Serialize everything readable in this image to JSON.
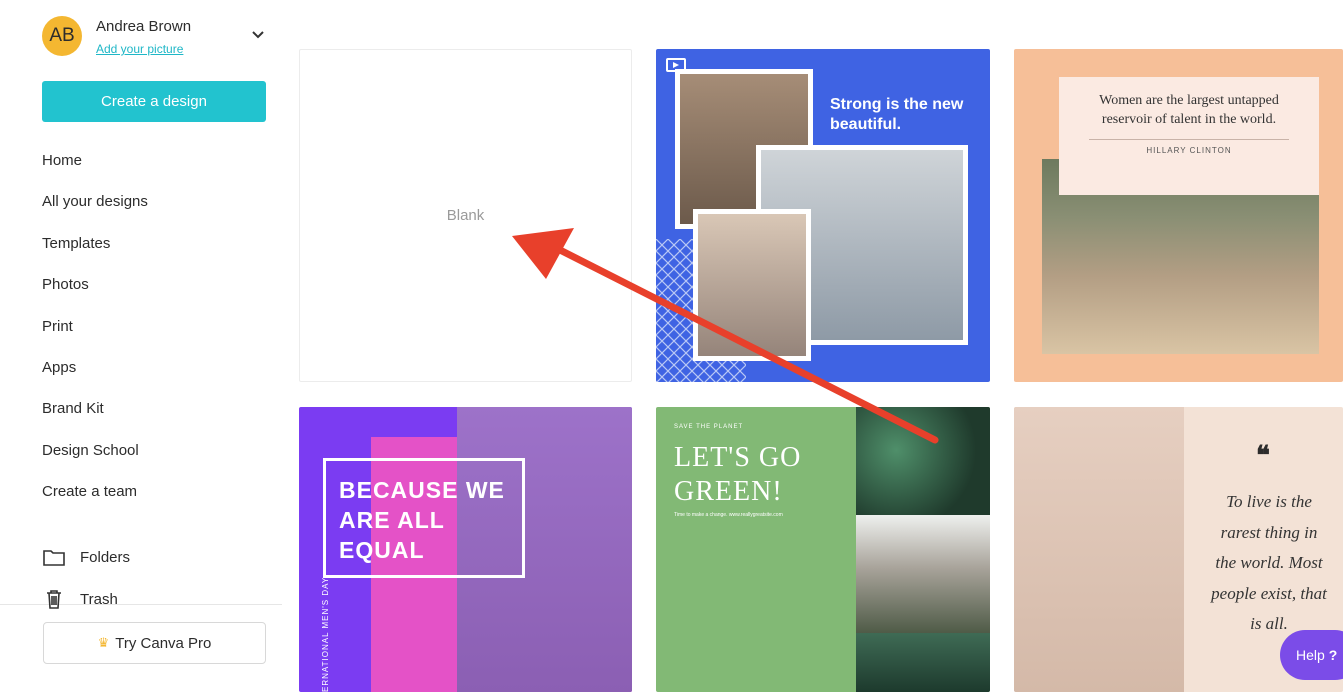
{
  "profile": {
    "initials": "AB",
    "name": "Andrea Brown",
    "link": "Add your picture"
  },
  "sidebar": {
    "create_button": "Create a design",
    "items": [
      {
        "label": "Home"
      },
      {
        "label": "All your designs"
      },
      {
        "label": "Templates"
      },
      {
        "label": "Photos"
      },
      {
        "label": "Print"
      },
      {
        "label": "Apps"
      },
      {
        "label": "Brand Kit"
      },
      {
        "label": "Design School"
      },
      {
        "label": "Create a team"
      }
    ],
    "folders_label": "Folders",
    "trash_label": "Trash",
    "pro_button": "Try Canva Pro"
  },
  "tiles": {
    "blank_label": "Blank",
    "strong_text": "Strong is the new beautiful.",
    "quote_text": "Women are the largest untapped reservoir of talent in the world.",
    "quote_author": "HILLARY CLINTON",
    "equal_text": "BECAUSE WE ARE ALL EQUAL",
    "womens_day": "ERNATIONAL MEN'S DAY",
    "green_top": "SAVE THE PLANET",
    "green_big": "LET'S GO GREEN!",
    "green_small": "Time to make a change. www.reallygreatsite.com",
    "life_mark": "❝",
    "life_quote": "To live is the rarest thing in the world. Most people exist, that is all."
  },
  "help": {
    "label": "Help",
    "q": "?"
  },
  "colors": {
    "accent": "#22c3cf",
    "avatar": "#f4b731",
    "arrow": "#e8402b",
    "help": "#7b4ce8"
  }
}
